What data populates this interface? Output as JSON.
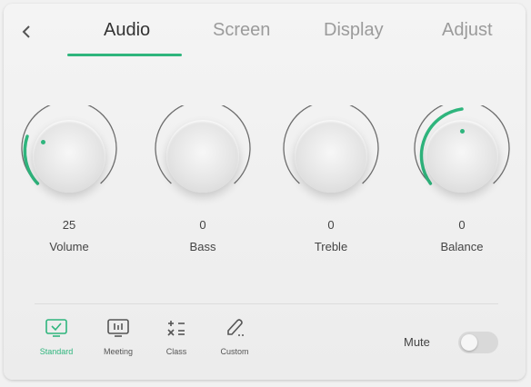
{
  "tabs": [
    {
      "label": "Audio",
      "active": true
    },
    {
      "label": "Screen",
      "active": false
    },
    {
      "label": "Display",
      "active": false
    },
    {
      "label": "Adjust",
      "active": false
    }
  ],
  "knobs": [
    {
      "label": "Volume",
      "value": "25"
    },
    {
      "label": "Bass",
      "value": "0"
    },
    {
      "label": "Treble",
      "value": "0"
    },
    {
      "label": "Balance",
      "value": "0"
    }
  ],
  "modes": [
    {
      "label": "Standard",
      "icon": "check-screen-icon",
      "active": true
    },
    {
      "label": "Meeting",
      "icon": "meeting-icon",
      "active": false
    },
    {
      "label": "Class",
      "icon": "math-icon",
      "active": false
    },
    {
      "label": "Custom",
      "icon": "pen-icon",
      "active": false
    }
  ],
  "mute": {
    "label": "Mute",
    "on": false
  },
  "colors": {
    "accent": "#2fb57d",
    "inactive_text": "#9b9b9b",
    "track": "#6d6d6d"
  }
}
